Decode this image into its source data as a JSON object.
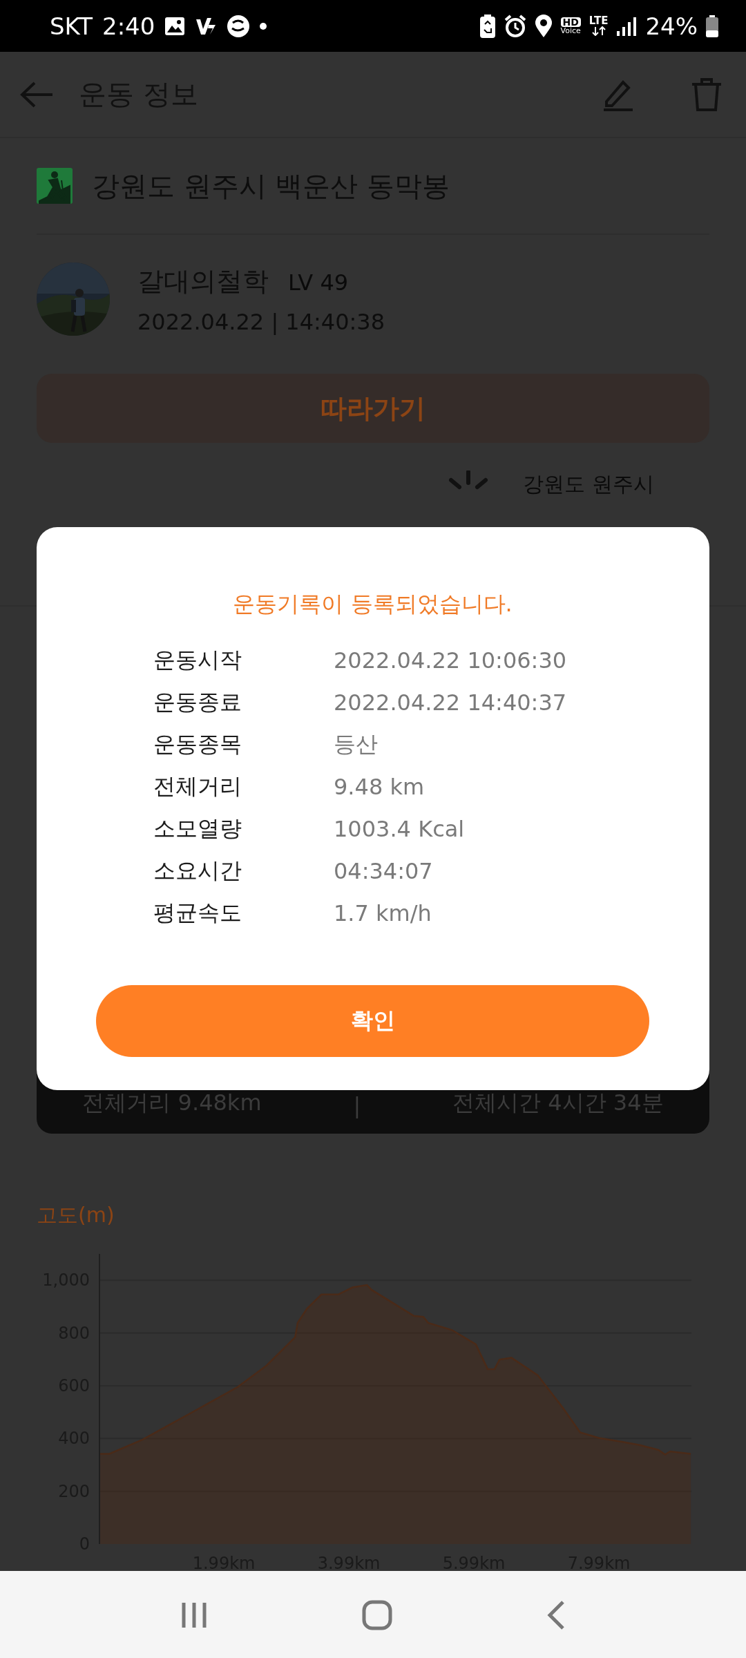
{
  "status_bar": {
    "carrier": "SKT",
    "time": "2:40",
    "hd": "HD",
    "voice": "Voice",
    "network": "LTE",
    "battery": "24%"
  },
  "header": {
    "title": "운동 정보"
  },
  "record": {
    "title": "강원도 원주시 백운산 동막봉",
    "user": {
      "name": "갈대의철학",
      "level": "LV 49"
    },
    "datetime": "2022.04.22 | 14:40:38",
    "follow_button": "따라가기",
    "location": "강원도 원주시"
  },
  "summary": {
    "distance": "전체거리 9.48km",
    "separator": "|",
    "duration": "전체시간 4시간 34분"
  },
  "elevation": {
    "title": "고도(m)",
    "chart_data": {
      "type": "area",
      "x": [
        0,
        0.16,
        0.69,
        1.45,
        2.21,
        2.67,
        3.13,
        3.17,
        3.32,
        3.55,
        3.82,
        4.05,
        4.28,
        4.35,
        5.03,
        5.18,
        5.26,
        5.64,
        6.02,
        6.21,
        6.32,
        6.4,
        6.59,
        7.01,
        7.42,
        7.69,
        7.99,
        8.37,
        8.64,
        8.94,
        9.05,
        9.13,
        9.46
      ],
      "series": [
        {
          "color": "#4a2a18",
          "values": [
            342,
            342,
            396,
            495,
            595,
            676,
            784,
            838,
            892,
            946,
            946,
            973,
            982,
            964,
            865,
            861,
            838,
            811,
            757,
            663,
            663,
            699,
            706,
            640,
            514,
            423,
            402,
            387,
            375,
            357,
            339,
            351,
            342
          ]
        }
      ],
      "grid": true,
      "xlim": [
        0,
        9.47
      ],
      "ylim": [
        0,
        1100
      ],
      "xticks": [
        {
          "value": 1.99,
          "label": "1.99km"
        },
        {
          "value": 3.99,
          "label": "3.99km"
        },
        {
          "value": 5.99,
          "label": "5.99km"
        },
        {
          "value": 7.99,
          "label": "7.99km"
        }
      ],
      "yticks": [
        0,
        200,
        400,
        600,
        800,
        {
          "value": 1000,
          "label": "1,000"
        }
      ]
    }
  },
  "dialog": {
    "title": "운동기록이 등록되었습니다.",
    "rows": [
      {
        "label": "운동시작",
        "value": "2022.04.22 10:06:30"
      },
      {
        "label": "운동종료",
        "value": "2022.04.22 14:40:37"
      },
      {
        "label": "운동종목",
        "value": "등산"
      },
      {
        "label": "전체거리",
        "value": "9.48 km"
      },
      {
        "label": "소모열량",
        "value": "1003.4 Kcal"
      },
      {
        "label": "소요시간",
        "value": "04:34:07"
      },
      {
        "label": "평균속도",
        "value": "1.7 km/h"
      }
    ],
    "confirm_button": "확인"
  }
}
